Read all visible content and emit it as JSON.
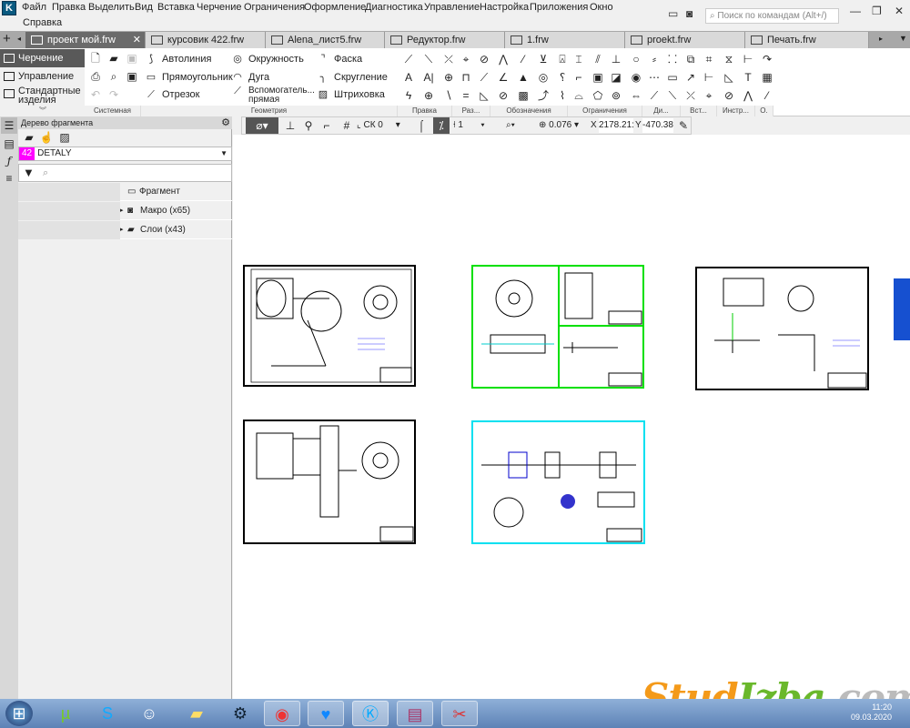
{
  "app": {
    "title_icon": "kompas-logo"
  },
  "menu": [
    "Файл",
    "Правка",
    "Выделить",
    "Вид",
    "Вставка",
    "Черчение",
    "Ограничения",
    "Оформление",
    "Диагностика",
    "Управление",
    "Настройка",
    "Приложения",
    "Окно",
    "Справка"
  ],
  "search": {
    "placeholder": "Поиск по командам (Alt+/)"
  },
  "tabs": [
    "проект мой.frw",
    "курсовик 422.frw",
    "Alena_лист5.frw",
    "Редуктор.frw",
    "1.frw",
    "proekt.frw",
    "Печать.frw"
  ],
  "modes": [
    "Черчение",
    "Управление",
    "Стандартные изделия"
  ],
  "ribbon": {
    "groups": [
      "Системная",
      "Геометрия",
      "Правка",
      "Раз...",
      "Обозначения",
      "Ограничения",
      "Ди...",
      "Вст...",
      "Инстр...",
      "О."
    ],
    "geometry": [
      "Автолиния",
      "Окружность",
      "Фаска",
      "Прямоугольник",
      "Дуга",
      "Скругление",
      "Отрезок",
      "Вспомогатель... прямая",
      "Штриховка"
    ]
  },
  "tree": {
    "title": "Дерево фрагмента",
    "layer_num": "42",
    "layer_name": "DETALY",
    "items": [
      "Фрагмент",
      "Макро (x65)",
      "Слои (x43)"
    ]
  },
  "drawtool": {
    "cs": "СК 0",
    "step": "1",
    "zoom": "0.076",
    "x_label": "X",
    "x": "2178.21:",
    "y_label": "Y",
    "y": "-470.383"
  },
  "taskbar": {
    "apps": [
      "start",
      "utorrent",
      "skype",
      "discord",
      "explorer",
      "steam",
      "chrome",
      "heart-app",
      "kompas",
      "winrar",
      "scissors"
    ],
    "time": "11:20",
    "date": "09.03.2020"
  },
  "watermark": "StudIzba.com",
  "colors": {
    "accent": "#595959",
    "sheet_green": "#00e000",
    "sheet_cyan": "#00e0f0",
    "layer": "#ff00ff"
  }
}
